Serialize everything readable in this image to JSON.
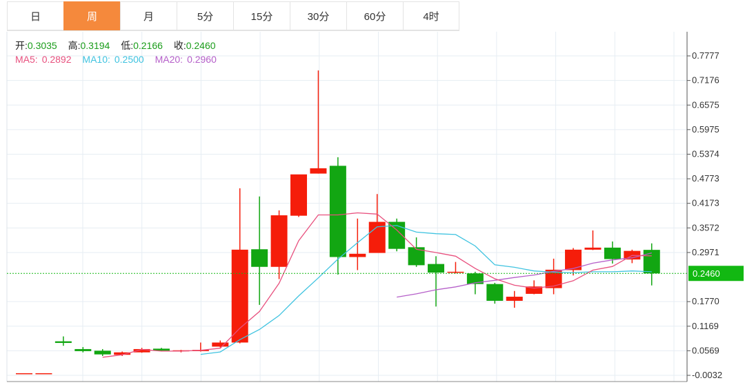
{
  "tabs": [
    {
      "label": "日",
      "active": false
    },
    {
      "label": "周",
      "active": true
    },
    {
      "label": "月",
      "active": false
    },
    {
      "label": "5分",
      "active": false
    },
    {
      "label": "15分",
      "active": false
    },
    {
      "label": "30分",
      "active": false
    },
    {
      "label": "60分",
      "active": false
    },
    {
      "label": "4时",
      "active": false
    }
  ],
  "ohlc_info": {
    "open_label": "开:",
    "open_value": "0.3035",
    "high_label": "高:",
    "high_value": "0.3194",
    "low_label": "低:",
    "low_value": "0.2166",
    "close_label": "收:",
    "close_value": "0.2460"
  },
  "ma_info": {
    "ma5_label": "MA5:",
    "ma5_value": "0.2892",
    "ma10_label": "MA10:",
    "ma10_value": "0.2500",
    "ma20_label": "MA20:",
    "ma20_value": "0.2960"
  },
  "colors": {
    "up": "#f51d0a",
    "down": "#12a612",
    "ma5": "#e8507e",
    "ma10": "#3fc3e0",
    "ma20": "#b55fc9",
    "grid": "#e6edf3",
    "last_price_bg": "#12b812",
    "active_tab": "#f5893c"
  },
  "chart_data": {
    "type": "candlestick",
    "y_ticks": [
      "0.7777",
      "0.7176",
      "0.6575",
      "0.5975",
      "0.5374",
      "0.4773",
      "0.4173",
      "0.3572",
      "0.2971",
      "0.1770",
      "0.1169",
      "0.0569",
      "-0.0032"
    ],
    "ylim": [
      -0.0032,
      0.7777
    ],
    "last_price": "0.2460",
    "grid": true,
    "candles": [
      {
        "open": 0.002,
        "high": 0.002,
        "low": 0.002,
        "close": 0.002
      },
      {
        "open": 0.002,
        "high": 0.002,
        "low": 0.002,
        "close": 0.002
      },
      {
        "open": 0.08,
        "high": 0.092,
        "low": 0.069,
        "close": 0.076
      },
      {
        "open": 0.061,
        "high": 0.066,
        "low": 0.053,
        "close": 0.056
      },
      {
        "open": 0.057,
        "high": 0.061,
        "low": 0.044,
        "close": 0.048
      },
      {
        "open": 0.047,
        "high": 0.055,
        "low": 0.044,
        "close": 0.053
      },
      {
        "open": 0.053,
        "high": 0.064,
        "low": 0.052,
        "close": 0.061
      },
      {
        "open": 0.062,
        "high": 0.064,
        "low": 0.056,
        "close": 0.057
      },
      {
        "open": 0.056,
        "high": 0.059,
        "low": 0.053,
        "close": 0.058
      },
      {
        "open": 0.056,
        "high": 0.077,
        "low": 0.055,
        "close": 0.059
      },
      {
        "open": 0.067,
        "high": 0.082,
        "low": 0.065,
        "close": 0.077
      },
      {
        "open": 0.077,
        "high": 0.454,
        "low": 0.075,
        "close": 0.304
      },
      {
        "open": 0.305,
        "high": 0.434,
        "low": 0.169,
        "close": 0.262
      },
      {
        "open": 0.262,
        "high": 0.4,
        "low": 0.232,
        "close": 0.388
      },
      {
        "open": 0.387,
        "high": 0.432,
        "low": 0.384,
        "close": 0.488
      },
      {
        "open": 0.49,
        "high": 0.742,
        "low": 0.49,
        "close": 0.503
      },
      {
        "open": 0.509,
        "high": 0.53,
        "low": 0.243,
        "close": 0.286
      },
      {
        "open": 0.286,
        "high": 0.38,
        "low": 0.254,
        "close": 0.294
      },
      {
        "open": 0.296,
        "high": 0.44,
        "low": 0.297,
        "close": 0.372
      },
      {
        "open": 0.372,
        "high": 0.38,
        "low": 0.3,
        "close": 0.306
      },
      {
        "open": 0.31,
        "high": 0.334,
        "low": 0.262,
        "close": 0.266
      },
      {
        "open": 0.269,
        "high": 0.288,
        "low": 0.165,
        "close": 0.248
      },
      {
        "open": 0.248,
        "high": 0.274,
        "low": 0.246,
        "close": 0.25
      },
      {
        "open": 0.246,
        "high": 0.25,
        "low": 0.195,
        "close": 0.22
      },
      {
        "open": 0.22,
        "high": 0.223,
        "low": 0.172,
        "close": 0.179
      },
      {
        "open": 0.179,
        "high": 0.203,
        "low": 0.162,
        "close": 0.189
      },
      {
        "open": 0.196,
        "high": 0.229,
        "low": 0.195,
        "close": 0.214
      },
      {
        "open": 0.21,
        "high": 0.282,
        "low": 0.195,
        "close": 0.255
      },
      {
        "open": 0.254,
        "high": 0.308,
        "low": 0.241,
        "close": 0.304
      },
      {
        "open": 0.304,
        "high": 0.351,
        "low": 0.303,
        "close": 0.309
      },
      {
        "open": 0.309,
        "high": 0.324,
        "low": 0.27,
        "close": 0.281
      },
      {
        "open": 0.28,
        "high": 0.304,
        "low": 0.271,
        "close": 0.301
      },
      {
        "open": 0.3035,
        "high": 0.3194,
        "low": 0.2166,
        "close": 0.246
      }
    ],
    "ma5": [
      null,
      null,
      null,
      null,
      0.041,
      0.047,
      0.06,
      0.056,
      0.056,
      0.058,
      0.063,
      0.112,
      0.153,
      0.222,
      0.326,
      0.389,
      0.389,
      0.394,
      0.391,
      0.352,
      0.305,
      0.297,
      0.288,
      0.258,
      0.233,
      0.217,
      0.21,
      0.215,
      0.228,
      0.254,
      0.263,
      0.29,
      0.289
    ],
    "ma10": [
      null,
      null,
      null,
      null,
      null,
      null,
      null,
      null,
      null,
      0.048,
      0.054,
      0.084,
      0.109,
      0.143,
      0.191,
      0.235,
      0.281,
      0.321,
      0.36,
      0.363,
      0.347,
      0.343,
      0.341,
      0.313,
      0.267,
      0.261,
      0.252,
      0.249,
      0.248,
      0.25,
      0.25,
      0.252,
      0.25
    ],
    "ma20": [
      null,
      null,
      null,
      null,
      null,
      null,
      null,
      null,
      null,
      null,
      null,
      null,
      null,
      null,
      null,
      null,
      null,
      null,
      null,
      0.188,
      0.196,
      0.206,
      0.213,
      0.223,
      0.229,
      0.236,
      0.242,
      0.251,
      0.258,
      0.271,
      0.279,
      0.284,
      0.296
    ]
  }
}
